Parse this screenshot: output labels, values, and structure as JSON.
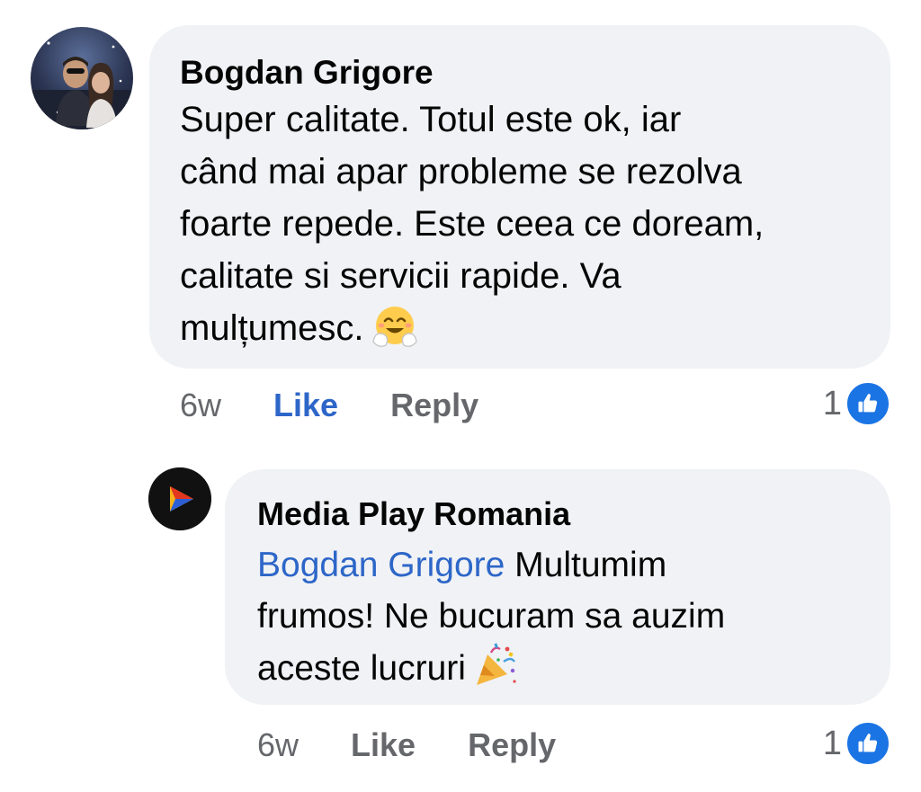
{
  "comment": {
    "author": "Bogdan Grigore",
    "text_lines": [
      "Super calitate. Totul este ok, iar",
      "când mai apar probleme se rezolva",
      "foarte repede. Este ceea ce doream,",
      "calitate si servicii rapide. Va",
      "mulțumesc."
    ],
    "emoji_icon": "hugging-face-icon",
    "time": "6w",
    "like_label": "Like",
    "like_active": true,
    "reply_label": "Reply",
    "reaction_count": "1",
    "reaction_icon": "thumbs-up-icon"
  },
  "reply": {
    "author": "Media Play Romania",
    "mention": "Bogdan Grigore",
    "text_lines": [
      " Multumim",
      "frumos! Ne bucuram sa auzim",
      "aceste lucruri"
    ],
    "emoji_icon": "party-popper-icon",
    "time": "6w",
    "like_label": "Like",
    "reply_label": "Reply",
    "reaction_count": "1",
    "reaction_icon": "thumbs-up-icon"
  },
  "colors": {
    "bubble": "#f0f2f5",
    "link_blue": "#2d66c8",
    "secondary_text": "#65676b",
    "like_badge": "#1b74e4"
  }
}
